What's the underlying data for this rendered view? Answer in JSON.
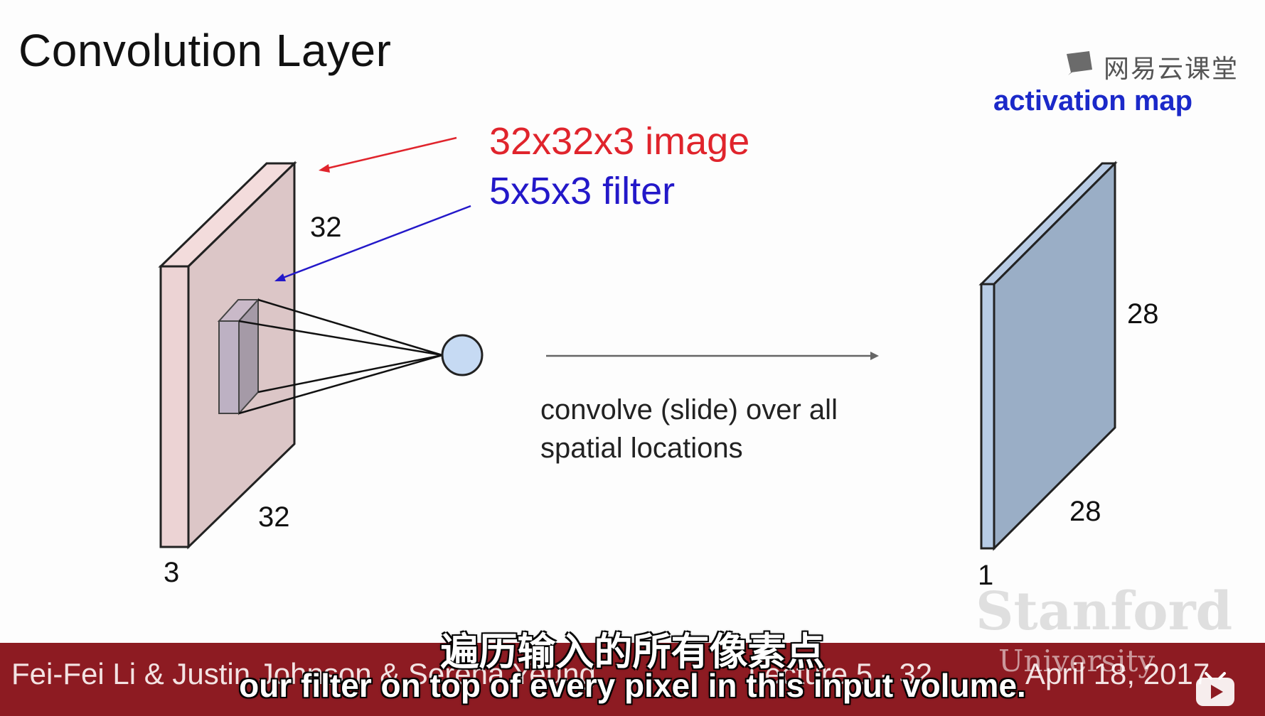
{
  "slide": {
    "title": "Convolution Layer",
    "input_label": "32x32x3 image",
    "filter_label": "5x5x3 filter",
    "activation_label": "activation map",
    "input_dims": {
      "height": "32",
      "width": "32",
      "depth": "3"
    },
    "output_dims": {
      "height": "28",
      "width": "28",
      "depth": "1"
    },
    "caption": "convolve (slide) over all\nspatial locations",
    "colors": {
      "input_red": "#e0242c",
      "filter_blue": "#2318c9",
      "activation_blue": "#1b29c9",
      "input_volume": "#e8cfd0",
      "activation_volume": "#9aaec6",
      "neuron": "#c6daf3",
      "footer": "#8d1b22"
    }
  },
  "watermark": {
    "brand": "网易云课堂",
    "institution": "Stanford",
    "institution_sub": "University"
  },
  "footer": {
    "authors": "Fei-Fei Li & Justin Johnson & Serena Yeung",
    "lecture": "Lecture 5 - 32",
    "date": "April 18, 2017"
  },
  "subtitles": {
    "chinese": "遍历输入的所有像素点",
    "english": "our filter on top of every pixel in this input volume."
  },
  "icons": {
    "brand": "netease-logo-icon",
    "player": "play-button-icon"
  }
}
